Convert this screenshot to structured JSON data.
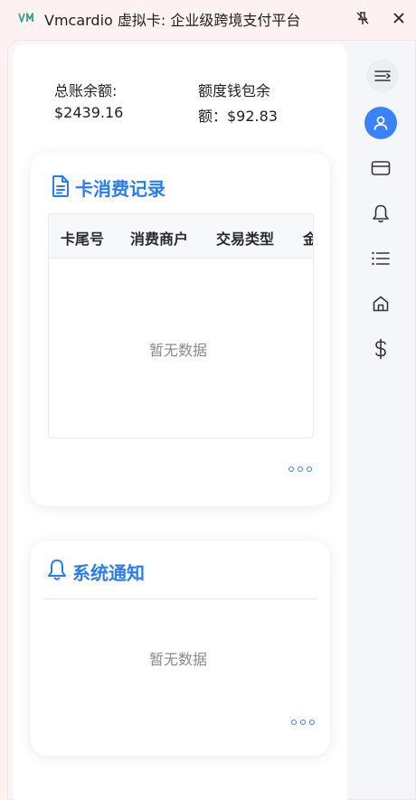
{
  "window": {
    "title": "Vmcardio 虚拟卡: 企业级跨境支付平台",
    "logo_icon": "vm-logo-icon"
  },
  "balances": {
    "total_label": "总账余额:",
    "total_value": "$2439.16",
    "quota_label_line1": "额度钱包余",
    "quota_label_line2": "额：$92.83"
  },
  "card_records": {
    "title": "卡消费记录",
    "columns": [
      "卡尾号",
      "消费商户",
      "交易类型",
      "金"
    ],
    "empty_text": "暂无数据"
  },
  "notifications": {
    "title": "系统通知",
    "empty_text": "暂无数据"
  },
  "sidebar": {
    "items": [
      {
        "icon": "menu-collapse-icon"
      },
      {
        "icon": "user-icon",
        "active": true
      },
      {
        "icon": "credit-card-icon"
      },
      {
        "icon": "bell-icon"
      },
      {
        "icon": "list-icon"
      },
      {
        "icon": "home-icon"
      },
      {
        "icon": "dollar-icon"
      }
    ]
  },
  "colors": {
    "accent": "#3b82f6",
    "title_blue": "#2b7de9",
    "titlebar_bg": "#fdf2f1"
  }
}
